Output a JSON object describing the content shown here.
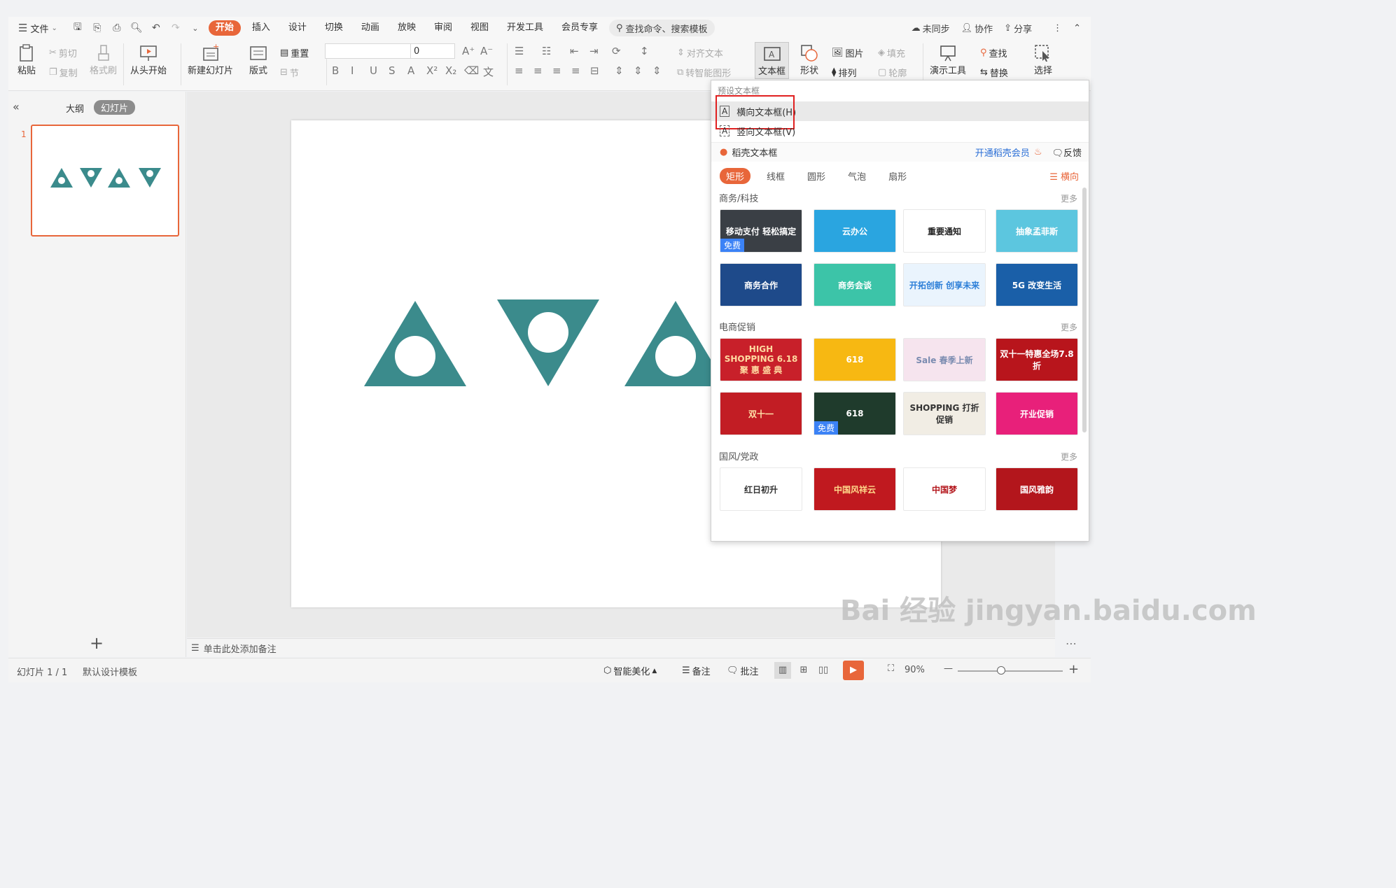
{
  "menubar": {
    "file_label": "文件",
    "tabs": [
      "开始",
      "插入",
      "设计",
      "切换",
      "动画",
      "放映",
      "审阅",
      "视图",
      "开发工具",
      "会员专享"
    ],
    "active_tab": "开始",
    "search_placeholder": "查找命令、搜索模板",
    "sync_label": "未同步",
    "collab_label": "协作",
    "share_label": "分享"
  },
  "ribbon": {
    "paste": "粘贴",
    "cut": "剪切",
    "copy": "复制",
    "format_painter": "格式刷",
    "from_start": "从头开始",
    "new_slide": "新建幻灯片",
    "layout": "版式",
    "reset": "重置",
    "section": "节",
    "font_size_value": "0",
    "align_text": "对齐文本",
    "convert_smartart": "转智能图形",
    "textbox": "文本框",
    "shape": "形状",
    "picture": "图片",
    "arrange": "排列",
    "fill": "填充",
    "outline": "轮廓",
    "presentation_tools": "演示工具",
    "find": "查找",
    "replace": "替换",
    "select": "选择"
  },
  "leftpanel": {
    "tab_outline": "大纲",
    "tab_slides": "幻灯片",
    "slide_number": "1",
    "add_symbol": "+"
  },
  "notes_placeholder": "单击此处添加备注",
  "statusbar": {
    "slide_info": "幻灯片 1 / 1",
    "template": "默认设计模板",
    "beautify": "智能美化",
    "notes": "备注",
    "comments": "批注",
    "zoom": "90%"
  },
  "dropdown": {
    "preset_header": "预设文本框",
    "horizontal": "横向文本框(H)",
    "vertical": "竖向文本框(V)",
    "docer_header": "稻壳文本框",
    "member_link": "开通稻壳会员",
    "feedback": "反馈",
    "categories": [
      "矩形",
      "线框",
      "圆形",
      "气泡",
      "扇形"
    ],
    "orientation": "横向",
    "more": "更多",
    "sections": [
      {
        "title": "商务/科技",
        "templates": [
          {
            "text": "移动支付 轻松搞定",
            "badge": "免费",
            "bg": "#3a3f45",
            "fg": "#ffffff"
          },
          {
            "text": "云办公",
            "badge": "",
            "bg": "#2aa5e0",
            "fg": "#ffffff"
          },
          {
            "text": "重要通知",
            "badge": "",
            "bg": "#ffffff",
            "fg": "#222222"
          },
          {
            "text": "抽象孟菲斯",
            "badge": "",
            "bg": "#5cc6df",
            "fg": "#ffffff"
          },
          {
            "text": "商务合作",
            "badge": "",
            "bg": "#1e4a8a",
            "fg": "#ffffff"
          },
          {
            "text": "商务会谈",
            "badge": "",
            "bg": "#3cc4a8",
            "fg": "#ffffff"
          },
          {
            "text": "开拓创新 创享未来",
            "badge": "",
            "bg": "#eaf4fd",
            "fg": "#2d7fd8"
          },
          {
            "text": "5G 改变生活",
            "badge": "",
            "bg": "#1a5fa8",
            "fg": "#ffffff"
          }
        ]
      },
      {
        "title": "电商促销",
        "templates": [
          {
            "text": "HIGH SHOPPING 6.18 聚 惠 盛 典",
            "badge": "",
            "bg": "#c8202a",
            "fg": "#ffd9a0"
          },
          {
            "text": "618",
            "badge": "",
            "bg": "#f7b812",
            "fg": "#ffffff"
          },
          {
            "text": "Sale 春季上新",
            "badge": "",
            "bg": "#f6e4ee",
            "fg": "#7a8bb0"
          },
          {
            "text": "双十一特惠全场7.8折",
            "badge": "",
            "bg": "#b8151c",
            "fg": "#ffffff"
          },
          {
            "text": "双十一",
            "badge": "",
            "bg": "#c21d24",
            "fg": "#ffe1a8"
          },
          {
            "text": "618",
            "badge": "免费",
            "bg": "#1f3b2c",
            "fg": "#ffffff"
          },
          {
            "text": "SHOPPING 打折促销",
            "badge": "",
            "bg": "#f1ede4",
            "fg": "#333333"
          },
          {
            "text": "开业促销",
            "badge": "",
            "bg": "#e8207a",
            "fg": "#ffffff"
          }
        ]
      },
      {
        "title": "国风/党政",
        "templates": [
          {
            "text": "红日初升",
            "badge": "",
            "bg": "#ffffff",
            "fg": "#333333"
          },
          {
            "text": "中国风祥云",
            "badge": "",
            "bg": "#c0191f",
            "fg": "#ffd88a"
          },
          {
            "text": "中国梦",
            "badge": "",
            "bg": "#ffffff",
            "fg": "#b3161c"
          },
          {
            "text": "国风雅韵",
            "badge": "",
            "bg": "#b3161c",
            "fg": "#ffffff"
          }
        ]
      }
    ]
  },
  "colors": {
    "accent": "#e8663a",
    "shape_teal": "#3b8b8c",
    "highlight_box": "#e02020"
  },
  "watermark": "Bai 经验 jingyan.baidu.com"
}
